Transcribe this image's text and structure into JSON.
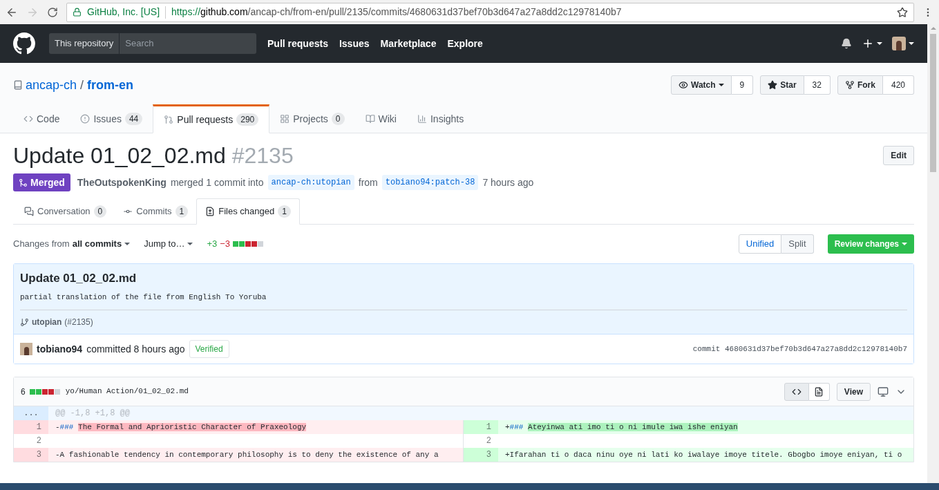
{
  "browser": {
    "site_identity": "GitHub, Inc. [US]",
    "url_scheme": "https://",
    "url_host": "github.com",
    "url_path": "/ancap-ch/from-en/pull/2135/commits/4680631d37bef70b3d647a27a8dd2c12978140b7"
  },
  "header": {
    "scope": "This repository",
    "search_placeholder": "Search",
    "nav": [
      "Pull requests",
      "Issues",
      "Marketplace",
      "Explore"
    ]
  },
  "repo": {
    "owner": "ancap-ch",
    "separator": "/",
    "name": "from-en",
    "actions": [
      {
        "label": "Watch",
        "count": "9",
        "kind": "watch"
      },
      {
        "label": "Star",
        "count": "32",
        "kind": "star"
      },
      {
        "label": "Fork",
        "count": "420",
        "kind": "fork"
      }
    ]
  },
  "repo_tabs": [
    {
      "label": "Code",
      "kind": "code",
      "selected": false
    },
    {
      "label": "Issues",
      "count": "44",
      "kind": "issue",
      "selected": false
    },
    {
      "label": "Pull requests",
      "count": "290",
      "kind": "pr",
      "selected": true
    },
    {
      "label": "Projects",
      "count": "0",
      "kind": "project",
      "selected": false
    },
    {
      "label": "Wiki",
      "kind": "wiki",
      "selected": false
    },
    {
      "label": "Insights",
      "kind": "insights",
      "selected": false
    }
  ],
  "pr": {
    "title": "Update 01_02_02.md",
    "number": "#2135",
    "edit": "Edit",
    "state": "Merged",
    "author": "TheOutspokenKing",
    "action": "merged 1 commit into",
    "base": "ancap-ch:utopian",
    "from": "from",
    "head": "tobiano94:patch-38",
    "time": "7 hours ago"
  },
  "pr_tabs": [
    {
      "label": "Conversation",
      "count": "0",
      "kind": "conversation",
      "selected": false
    },
    {
      "label": "Commits",
      "count": "1",
      "kind": "commit",
      "selected": false
    },
    {
      "label": "Files changed",
      "count": "1",
      "kind": "files",
      "selected": true
    }
  ],
  "toolbar": {
    "changes_prefix": "Changes from",
    "changes_value": "all commits",
    "jump": "Jump to…",
    "additions": "+3",
    "deletions": "−3",
    "diffstat": [
      {
        "kind": "added"
      },
      {
        "kind": "added"
      },
      {
        "kind": "deleted"
      },
      {
        "kind": "deleted"
      },
      {
        "kind": "neutral"
      }
    ],
    "view_modes": [
      {
        "label": "Unified",
        "selected": true
      },
      {
        "label": "Split",
        "selected": false
      }
    ],
    "review": "Review changes"
  },
  "commit": {
    "title": "Update 01_02_02.md",
    "description": "partial translation of the file from English To Yoruba",
    "branch": "utopian",
    "pr_ref": "(#2135)",
    "author": "tobiano94",
    "action": "committed 8 hours ago",
    "verified": "Verified",
    "sha_label": "commit",
    "sha": "4680631d37bef70b3d647a27a8dd2c12978140b7"
  },
  "file": {
    "changes": "6",
    "diffstat": [
      {
        "kind": "added"
      },
      {
        "kind": "added"
      },
      {
        "kind": "deleted"
      },
      {
        "kind": "deleted"
      },
      {
        "kind": "neutral"
      }
    ],
    "path": "yo/Human Action/01_02_02.md",
    "view": "View",
    "hunk": {
      "marker": "...",
      "header": "@@ -1,8 +1,8 @@"
    },
    "rows": [
      {
        "left": {
          "num": "1",
          "kind": "deleted",
          "sign": "-",
          "prefix": "###",
          "text": "The Formal and Aprioristic Character of Praxeology"
        },
        "right": {
          "num": "1",
          "kind": "added",
          "sign": "+",
          "prefix": "###",
          "text": "Ateyinwa ati imo ti o ni imule iwa ishe eniyan"
        }
      },
      {
        "left": {
          "num": "2",
          "kind": "context"
        },
        "right": {
          "num": "2",
          "kind": "context"
        }
      },
      {
        "left": {
          "num": "3",
          "kind": "deleted",
          "sign": "-",
          "text": "A fashionable tendency in contemporary philosophy is to deny the existence of any a"
        },
        "right": {
          "num": "3",
          "kind": "added",
          "sign": "+",
          "text": "Ifarahan ti o daca ninu oye ni lati ko iwalaye imoye titele. Gbogbo imoye eniyan, ti o"
        }
      }
    ]
  }
}
